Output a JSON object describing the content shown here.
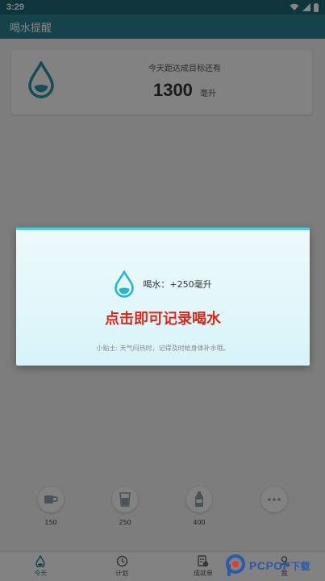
{
  "status_bar": {
    "time": "3:29"
  },
  "app_bar": {
    "title": "喝水提醒"
  },
  "goal_card": {
    "label": "今天距达成目标还有",
    "value": "1300",
    "unit": "毫升"
  },
  "quick_add": [
    {
      "label": "150",
      "icon": "cup-icon"
    },
    {
      "label": "250",
      "icon": "glass-icon"
    },
    {
      "label": "400",
      "icon": "bottle-icon"
    },
    {
      "label": "",
      "icon": "more-icon"
    }
  ],
  "bottom_nav": [
    {
      "label": "今天",
      "icon": "drop-icon",
      "active": true
    },
    {
      "label": "计划",
      "icon": "clock-icon"
    },
    {
      "label": "成就单",
      "icon": "report-icon"
    },
    {
      "label": "我",
      "icon": "person-icon"
    }
  ],
  "dialog": {
    "drink_text": "喝水：+250毫升",
    "headline": "点击即可记录喝水",
    "tip": "小贴士: 天气闷热时，记得及时给身体补水哦。"
  },
  "watermark": {
    "text": "PCPOP",
    "suffix": "下载"
  },
  "colors": {
    "primary": "#2b8091",
    "status": "#1d6573",
    "accent_red": "#d32b1e",
    "dialog_top": "#4fcde0"
  }
}
